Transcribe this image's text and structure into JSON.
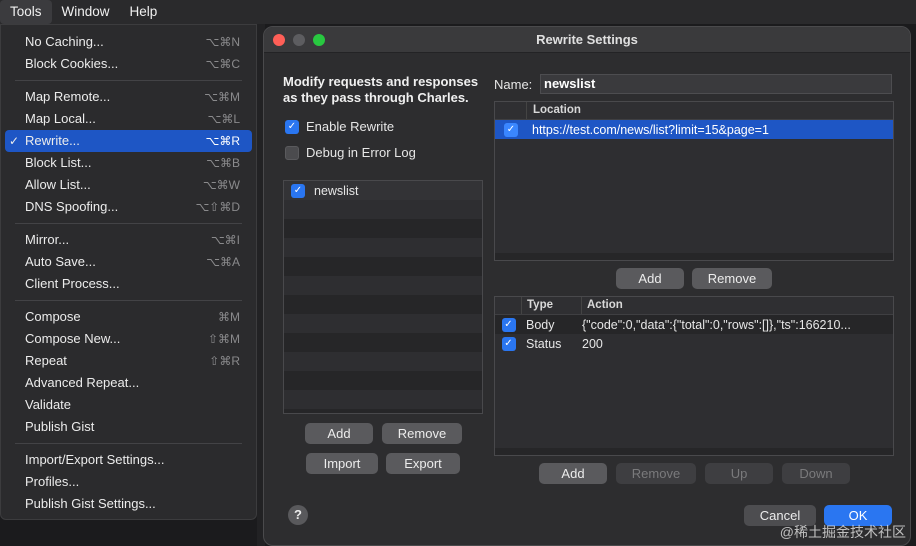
{
  "menubar": {
    "items": [
      "Tools",
      "Window",
      "Help"
    ]
  },
  "menu": {
    "groups": [
      [
        {
          "label": "No Caching...",
          "shortcut": "⌥⌘N"
        },
        {
          "label": "Block Cookies...",
          "shortcut": "⌥⌘C"
        }
      ],
      [
        {
          "label": "Map Remote...",
          "shortcut": "⌥⌘M"
        },
        {
          "label": "Map Local...",
          "shortcut": "⌥⌘L"
        },
        {
          "label": "Rewrite...",
          "shortcut": "⌥⌘R",
          "checked": true,
          "selected": true
        },
        {
          "label": "Block List...",
          "shortcut": "⌥⌘B"
        },
        {
          "label": "Allow List...",
          "shortcut": "⌥⌘W"
        },
        {
          "label": "DNS Spoofing...",
          "shortcut": "⌥⇧⌘D"
        }
      ],
      [
        {
          "label": "Mirror...",
          "shortcut": "⌥⌘I"
        },
        {
          "label": "Auto Save...",
          "shortcut": "⌥⌘A"
        },
        {
          "label": "Client Process...",
          "shortcut": ""
        }
      ],
      [
        {
          "label": "Compose",
          "shortcut": "⌘M"
        },
        {
          "label": "Compose New...",
          "shortcut": "⇧⌘M"
        },
        {
          "label": "Repeat",
          "shortcut": "⇧⌘R"
        },
        {
          "label": "Advanced Repeat...",
          "shortcut": ""
        },
        {
          "label": "Validate",
          "shortcut": ""
        },
        {
          "label": "Publish Gist",
          "shortcut": ""
        }
      ],
      [
        {
          "label": "Import/Export Settings...",
          "shortcut": ""
        },
        {
          "label": "Profiles...",
          "shortcut": ""
        },
        {
          "label": "Publish Gist Settings...",
          "shortcut": ""
        }
      ]
    ]
  },
  "dialog": {
    "title": "Rewrite Settings",
    "description": "Modify requests and responses as they pass through Charles.",
    "enable_rewrite": {
      "label": "Enable Rewrite",
      "checked": true
    },
    "debug_log": {
      "label": "Debug in Error Log",
      "checked": false
    },
    "sets": [
      {
        "name": "newslist",
        "checked": true
      }
    ],
    "sets_buttons": {
      "add": "Add",
      "remove": "Remove",
      "import": "Import",
      "export": "Export"
    },
    "name_label": "Name:",
    "name_value": "newslist",
    "locations": {
      "header": "Location",
      "rows": [
        {
          "value": "https://test.com/news/list?limit=15&page=1",
          "checked": true
        }
      ]
    },
    "location_buttons": {
      "add": "Add",
      "remove": "Remove"
    },
    "rules": {
      "headers": {
        "type": "Type",
        "action": "Action"
      },
      "rows": [
        {
          "type": "Body",
          "action": "{\"code\":0,\"data\":{\"total\":0,\"rows\":[]},\"ts\":166210...",
          "checked": true
        },
        {
          "type": "Status",
          "action": "200",
          "checked": true
        }
      ]
    },
    "rule_buttons": {
      "add": "Add",
      "remove": "Remove",
      "up": "Up",
      "down": "Down"
    },
    "footer": {
      "help": "?",
      "cancel": "Cancel",
      "ok": "OK"
    }
  },
  "watermark": "@稀土掘金技术社区",
  "colors": {
    "accent": "#2a76f1",
    "selection": "#1e56c5"
  }
}
